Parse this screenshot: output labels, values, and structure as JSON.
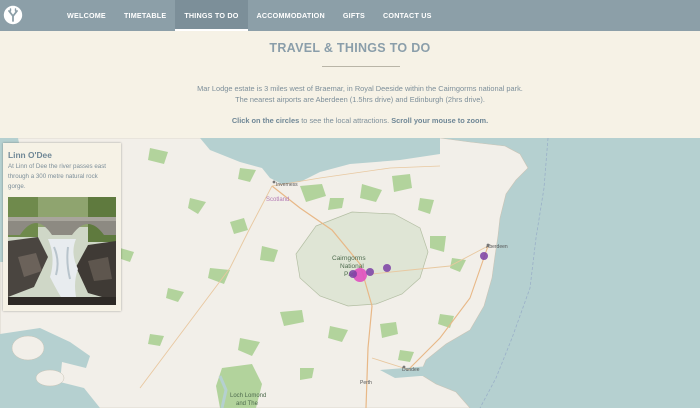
{
  "nav": {
    "logo_icon": "lodge-logo-icon",
    "items": [
      {
        "label": "WELCOME",
        "active": false
      },
      {
        "label": "TIMETABLE",
        "active": false
      },
      {
        "label": "THINGS TO DO",
        "active": true
      },
      {
        "label": "ACCOMMODATION",
        "active": false
      },
      {
        "label": "GIFTS",
        "active": false
      },
      {
        "label": "CONTACT US",
        "active": false
      }
    ]
  },
  "intro": {
    "title": "TRAVEL & THINGS TO DO",
    "line1": "Mar Lodge estate is 3 miles west of Braemar, in Royal Deeside within the Cairngorms national park.",
    "line2": "The nearest airports are Aberdeen (1.5hrs drive) and Edinburgh (2hrs drive).",
    "cta_click": "Click on the circles",
    "cta_middle": " to see the local attractions. ",
    "cta_scroll": "Scroll your mouse to zoom."
  },
  "map": {
    "labels": {
      "inverness": "Inverness",
      "scotland": "Scotland",
      "cairngorms1": "Cairngorms",
      "cairngorms2": "National",
      "cairngorms3": "Park",
      "aberdeen": "Aberdeen",
      "dundee": "Dundee",
      "perth": "Perth",
      "lochlomond1": "Loch Lomond",
      "lochlomond2": "and The"
    },
    "colors": {
      "sea": "#b5d0d0",
      "land": "#f2efe9",
      "park": "#dfe5d5",
      "forest": "#b2d39c",
      "marker": "#7b3fa5",
      "marker_active": "#e04fc0"
    }
  },
  "info_card": {
    "title": "Linn O'Dee",
    "description": "At Linn of Dee the river passes east through a 300 metre natural rock gorge."
  }
}
